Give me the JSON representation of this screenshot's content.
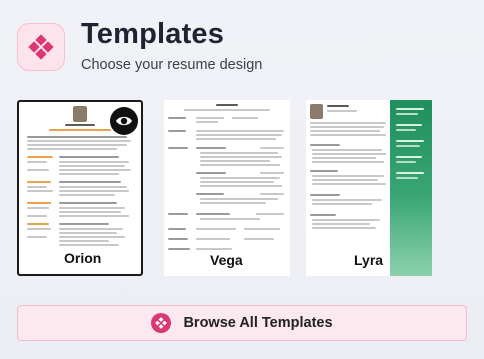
{
  "header": {
    "title": "Templates",
    "subtitle": "Choose your resume design",
    "brand_color": "#d93874",
    "logo_icon": "diamond-grid-icon"
  },
  "templates": [
    {
      "name": "Orion",
      "selected": true,
      "preview_icon": "eye-icon"
    },
    {
      "name": "Vega",
      "selected": false
    },
    {
      "name": "Lyra",
      "selected": false
    }
  ],
  "browse": {
    "label": "Browse All Templates",
    "icon": "diamond-grid-icon"
  }
}
